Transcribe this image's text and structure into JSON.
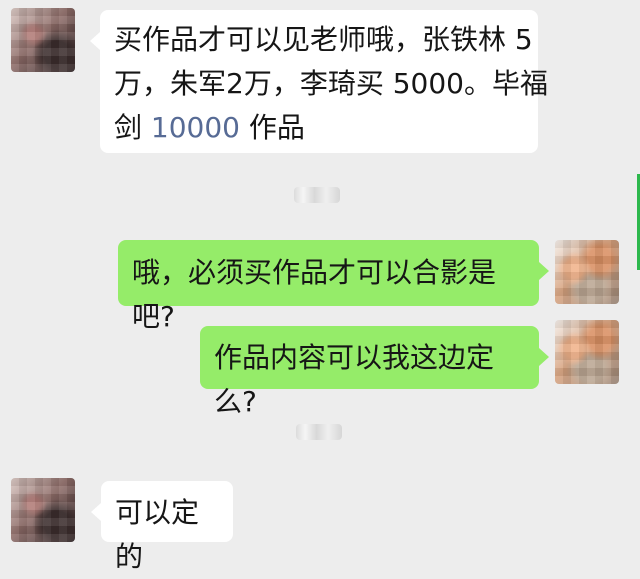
{
  "chat": {
    "messages": [
      {
        "lines": [
          "买作品才可以见老师哦，张铁林 5",
          "万，朱军2万，李琦买 5000。毕福",
          "剑",
          "10000",
          "作品"
        ]
      },
      {
        "text": "哦，必须买作品才可以合影是吧?"
      },
      {
        "text": "作品内容可以我这边定么?"
      },
      {
        "text": "可以定的"
      }
    ]
  },
  "icons": {
    "left_avatar": "avatar-image",
    "right_avatar": "avatar-image"
  }
}
